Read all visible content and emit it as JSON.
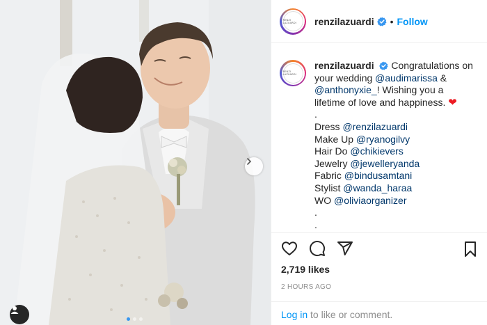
{
  "post": {
    "username": "renzilazuardi",
    "dot_separator": "•",
    "follow_label": "Follow",
    "avatar_text": "RENZI LAZUARDI",
    "caption": {
      "line1_text": "Congratulations on",
      "line2_text": "your wedding ",
      "mention_audi": "@audimarissa",
      "amp": " &",
      "mention_anthony": "@anthonyxie_",
      "wishing": "! Wishing you a",
      "line4": "lifetime of love and happiness.",
      "dot1": ".",
      "dress_label": "Dress ",
      "dress_mention": "@renzilazuardi",
      "makeup_label": "Make Up ",
      "makeup_mention": "@ryanogilvy",
      "hair_label": "Hair Do ",
      "hair_mention": "@chikievers",
      "jewelry_label": "Jewelry ",
      "jewelry_mention": "@jewelleryanda",
      "fabric_label": "Fabric ",
      "fabric_mention": "@bindusamtani",
      "stylist_label": "Stylist ",
      "stylist_mention": "@wanda_haraa",
      "wo_label": "WO ",
      "wo_mention": "@oliviaorganizer",
      "dot2": ".",
      "dot3": "."
    },
    "likes": "2,719 likes",
    "time": "2 HOURS AGO",
    "login_link": "Log in",
    "login_rest": " to like or comment."
  },
  "icons": {
    "like": "heart-icon",
    "comment": "comment-icon",
    "share": "share-icon",
    "save": "bookmark-icon",
    "next": "chevron-right-icon",
    "verified": "verified-badge-icon",
    "tag": "user-tag-icon"
  },
  "colors": {
    "link_blue": "#0095f6",
    "mention_blue": "#00376b",
    "heart_red": "#ed1c24",
    "verified_blue": "#3897f0"
  },
  "carousel": {
    "count": 3,
    "active_index": 0
  }
}
